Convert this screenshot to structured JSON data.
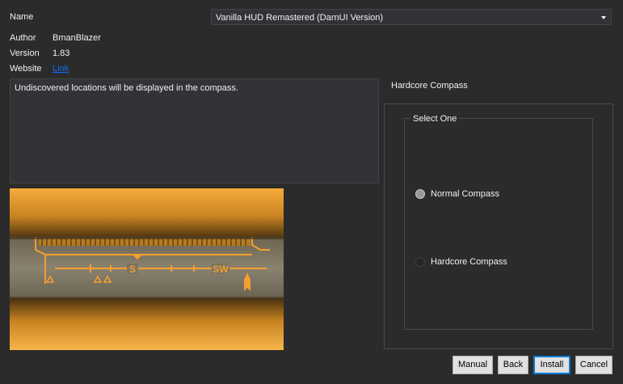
{
  "fields": {
    "name_label": "Name",
    "name_value": "Vanilla HUD Remastered (DarnUI Version)",
    "author_label": "Author",
    "author_value": "BmanBlazer",
    "version_label": "Version",
    "version_value": "1.83",
    "website_label": "Website",
    "website_value": "Link"
  },
  "description": "Undiscovered locations will be displayed in the compass.",
  "compass_preview": {
    "labels": [
      "S",
      "SW"
    ]
  },
  "group": {
    "title": "Hardcore Compass",
    "subgroup_title": "Select One",
    "options": [
      {
        "label": "Normal Compass",
        "selected": true
      },
      {
        "label": "Hardcore Compass",
        "selected": false
      }
    ]
  },
  "buttons": {
    "manual": "Manual",
    "back": "Back",
    "install": "Install",
    "cancel": "Cancel"
  },
  "colors": {
    "background": "#2b2b2b",
    "panel": "#333337",
    "accent_orange": "#f6a93b",
    "link": "#0b6cff"
  }
}
